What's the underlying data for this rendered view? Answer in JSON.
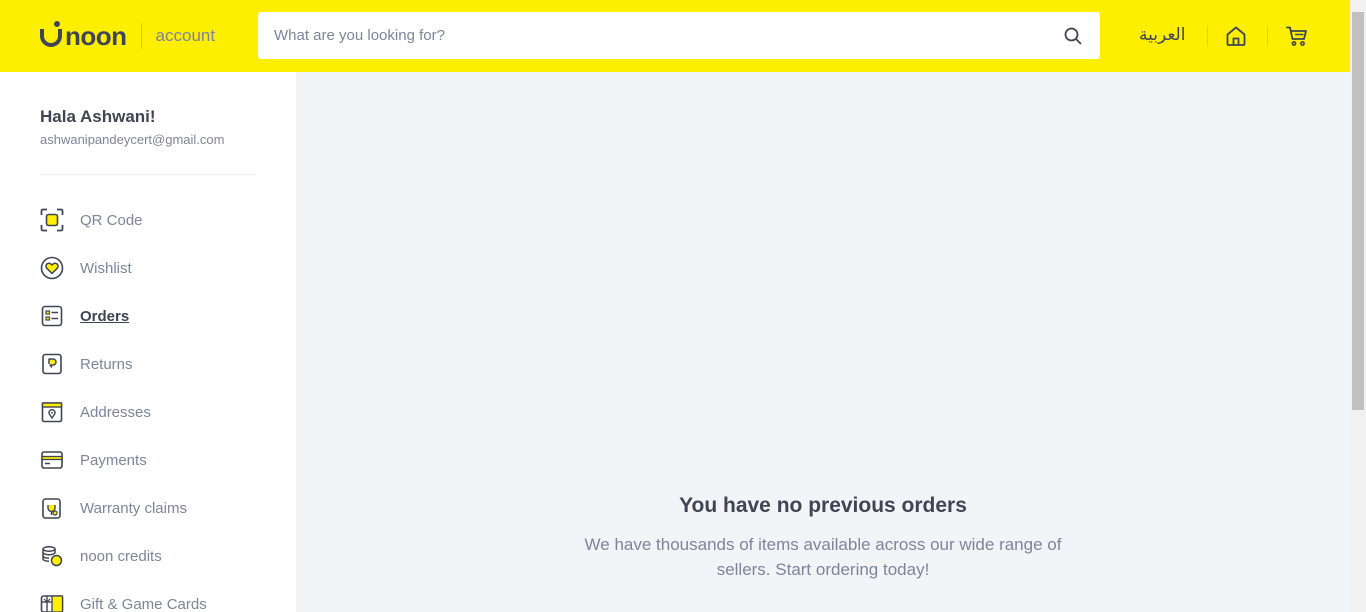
{
  "header": {
    "logo_text": "noon",
    "logo_subtitle": "account",
    "search_placeholder": "What are you looking for?",
    "language_label": "العربية",
    "brand_color": "#feee00"
  },
  "user": {
    "greeting": "Hala Ashwani!",
    "email": "ashwanipandeycert@gmail.com"
  },
  "sidebar": {
    "items": [
      {
        "label": "QR Code",
        "icon": "qr-code-icon"
      },
      {
        "label": "Wishlist",
        "icon": "heart-icon"
      },
      {
        "label": "Orders",
        "icon": "orders-icon",
        "active": true
      },
      {
        "label": "Returns",
        "icon": "returns-icon"
      },
      {
        "label": "Addresses",
        "icon": "address-icon"
      },
      {
        "label": "Payments",
        "icon": "card-icon"
      },
      {
        "label": "Warranty claims",
        "icon": "warranty-icon"
      },
      {
        "label": "noon credits",
        "icon": "coins-icon"
      },
      {
        "label": "Gift & Game Cards",
        "icon": "gift-card-icon"
      }
    ]
  },
  "main": {
    "empty_title": "You have no previous orders",
    "empty_description": "We have thousands of items available across our wide range of sellers. Start ordering today!"
  }
}
